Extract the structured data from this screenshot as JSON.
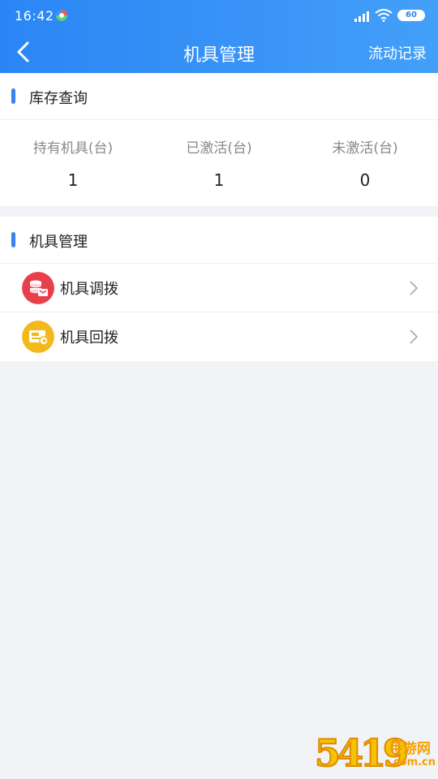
{
  "status_bar": {
    "time": "16:42",
    "battery": "60",
    "icons": [
      "app-icon",
      "signal-icon",
      "wifi-icon",
      "battery-icon"
    ]
  },
  "nav": {
    "back_icon": "chevron-left-icon",
    "title": "机具管理",
    "action": "流动记录"
  },
  "inventory": {
    "title": "库存查询",
    "stats": [
      {
        "label": "持有机具(台)",
        "value": "1"
      },
      {
        "label": "已激活(台)",
        "value": "1"
      },
      {
        "label": "未激活(台)",
        "value": "0"
      }
    ]
  },
  "management": {
    "title": "机具管理",
    "items": [
      {
        "label": "机具调拨",
        "icon": "transfer-icon",
        "icon_color": "#e8404a"
      },
      {
        "label": "机具回拨",
        "icon": "return-icon",
        "icon_color": "#f3b81c"
      }
    ]
  },
  "colors": {
    "header": "#2a86f5",
    "accent": "#3b82f2",
    "background": "#f2f3f7"
  },
  "watermark": {
    "digits": "5419",
    "text": "手游网",
    "domain": ".com.cn"
  }
}
